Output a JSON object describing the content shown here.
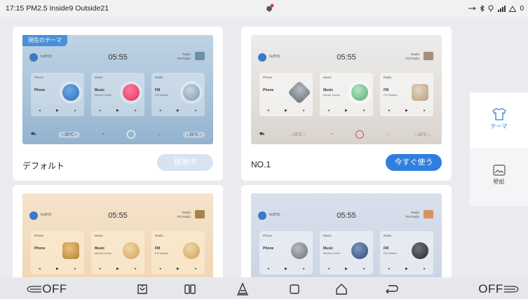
{
  "status_bar": {
    "time_text": "17:15 PM2.5 Inside9 Outside21",
    "right_indicator": "0"
  },
  "themes": [
    {
      "name": "デフォルト",
      "current_tag": "現在のテーマ",
      "button": "使用中",
      "preview": {
        "time": "05:55",
        "brand": "hi,BYD",
        "radio": "Radio",
        "radio_sub": "FM Radio",
        "tiles": [
          {
            "title": "Phone",
            "main": "Phone",
            "sub": ""
          },
          {
            "title": "Music",
            "main": "Music",
            "sub": "Media Center"
          },
          {
            "title": "Radio",
            "main": "FM",
            "sub": "FM Station"
          }
        ],
        "temp_left": "‹ 25℃ ›",
        "temp_right": "‹ 25℃ ›"
      }
    },
    {
      "name": "NO.1",
      "button": "今すぐ使う",
      "preview": {
        "time": "05:55",
        "brand": "hi,BYD",
        "radio": "Radio",
        "radio_sub": "FM Radio",
        "tiles": [
          {
            "title": "Phone",
            "main": "Phone",
            "sub": ""
          },
          {
            "title": "Music",
            "main": "Music",
            "sub": "Media Center"
          },
          {
            "title": "Radio",
            "main": "FM",
            "sub": "FM Station"
          }
        ],
        "temp_left": "‹ 25℃ ›",
        "temp_right": "‹ 25℃ ›"
      }
    },
    {
      "preview": {
        "time": "05:55",
        "brand": "hi,BYD",
        "radio": "Radio",
        "radio_sub": "FM Radio",
        "tiles": [
          {
            "title": "Phone",
            "main": "Phone",
            "sub": ""
          },
          {
            "title": "Music",
            "main": "Music",
            "sub": "Media Center"
          },
          {
            "title": "Radio",
            "main": "FM",
            "sub": "FM Station"
          }
        ]
      }
    },
    {
      "preview": {
        "time": "05:55",
        "brand": "hi,BYD",
        "radio": "Radio",
        "radio_sub": "FM Radio",
        "tiles": [
          {
            "title": "Phone",
            "main": "Phone",
            "sub": ""
          },
          {
            "title": "Music",
            "main": "Music",
            "sub": "Media Center"
          },
          {
            "title": "Radio",
            "main": "FM",
            "sub": "FM Station"
          }
        ]
      }
    }
  ],
  "sidebar": {
    "items": [
      {
        "label": "テーマ",
        "icon": "tshirt-icon",
        "active": true
      },
      {
        "label": "壁紙",
        "icon": "wallpaper-icon",
        "active": false
      }
    ]
  },
  "bottom_bar": {
    "left_fan": "OFF",
    "right_fan": "OFF"
  },
  "colors": {
    "accent": "#2f7fe0",
    "in_use_button": "#d7e3f2",
    "current_tag": "#4a90d9"
  }
}
